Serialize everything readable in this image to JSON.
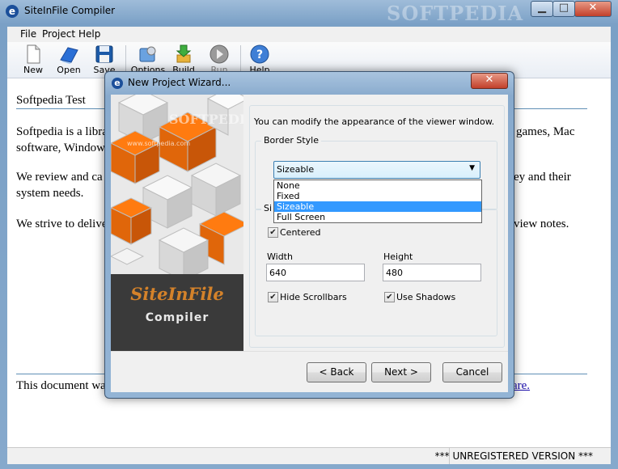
{
  "app": {
    "title": "SiteInFile Compiler",
    "icon_letter": "e",
    "watermark": "SOFTPEDIA"
  },
  "window_controls": {
    "minimize": "▁",
    "maximize": "□",
    "close": "✕"
  },
  "menu": [
    "File",
    "Project",
    "Help"
  ],
  "toolbar": {
    "items": [
      {
        "label": "New",
        "icon": "new-document-icon"
      },
      {
        "label": "Open",
        "icon": "open-book-icon"
      },
      {
        "label": "Save",
        "icon": "floppy-disk-icon"
      },
      {
        "label": "Options",
        "icon": "options-icon"
      },
      {
        "label": "Build",
        "icon": "build-arrow-icon"
      },
      {
        "label": "Run",
        "icon": "run-play-icon"
      },
      {
        "label": "Help",
        "icon": "help-icon"
      }
    ]
  },
  "document": {
    "heading": "Softpedia Test",
    "p1": "Softpedia is a libra",
    "p1_right": "games, Mac",
    "p1b": "software, Window",
    "p2": "We review and ca",
    "p2_right": "ey and their",
    "p2b": "system needs.",
    "p3": "We strive to delive",
    "p3_right": "view notes.",
    "footer_left": "This document wa",
    "footer_right": "are."
  },
  "status": {
    "text": "*** UNREGISTERED VERSION ***"
  },
  "dialog": {
    "title": "New Project Wizard...",
    "close_symbol": "✕",
    "banner": {
      "logo_title": "SiteInFile",
      "logo_sub": "Compiler",
      "watermark": "SOFTPEDIA",
      "watermark_url": "www.softpedia.com"
    },
    "intro": "You can modify the appearance of the viewer window.",
    "border_group": {
      "legend": "Border Style",
      "selected": "Sizeable",
      "options": [
        "None",
        "Fixed",
        "Sizeable",
        "Full Screen"
      ]
    },
    "size_group": {
      "legend": "Si",
      "centered_label": "Centered",
      "centered": true,
      "width_label": "Width",
      "width_value": "640",
      "height_label": "Height",
      "height_value": "480",
      "hide_scrollbars_label": "Hide Scrollbars",
      "hide_scrollbars": true,
      "use_shadows_label": "Use Shadows",
      "use_shadows": true
    },
    "buttons": {
      "back": "< Back",
      "next": "Next >",
      "cancel": "Cancel"
    }
  },
  "colors": {
    "accent_orange": "#f07a12",
    "selection_blue": "#3399ff",
    "title_bar": "#8fb0d3"
  }
}
